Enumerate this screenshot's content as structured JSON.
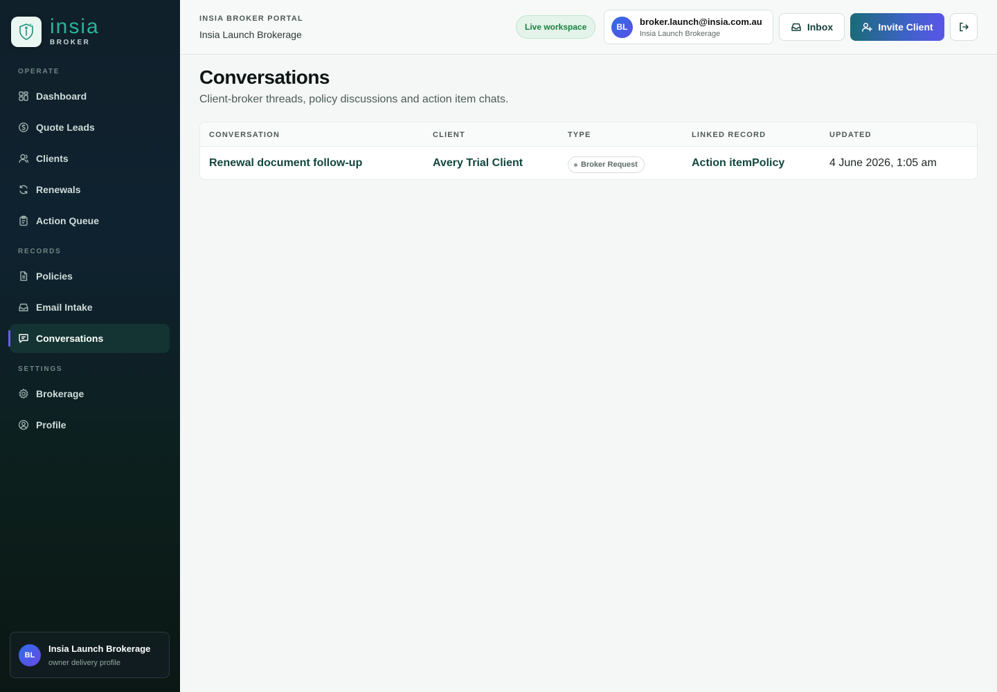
{
  "brand": {
    "name": "insia",
    "sub": "BROKER"
  },
  "sidebar": {
    "sections": {
      "operate": "OPERATE",
      "records": "RECORDS",
      "settings": "SETTINGS"
    },
    "items": [
      {
        "label": "Dashboard",
        "icon": "dashboard-icon"
      },
      {
        "label": "Quote Leads",
        "icon": "dollar-circle-icon"
      },
      {
        "label": "Clients",
        "icon": "user-icon"
      },
      {
        "label": "Renewals",
        "icon": "refresh-icon"
      },
      {
        "label": "Action Queue",
        "icon": "clipboard-icon"
      },
      {
        "label": "Policies",
        "icon": "document-icon"
      },
      {
        "label": "Email Intake",
        "icon": "inbox-icon"
      },
      {
        "label": "Conversations",
        "icon": "chat-icon",
        "active": true
      },
      {
        "label": "Brokerage",
        "icon": "gear-icon"
      },
      {
        "label": "Profile",
        "icon": "user-circle-icon"
      }
    ],
    "org_card": {
      "initials": "BL",
      "name": "Insia Launch Brokerage",
      "sub": "owner delivery profile"
    }
  },
  "header": {
    "portal_label": "INSIA BROKER PORTAL",
    "portal_sub": "Insia Launch Brokerage",
    "workspace_status": "Live workspace",
    "user": {
      "initials": "BL",
      "email": "broker.launch@insia.com.au",
      "org": "Insia Launch Brokerage"
    },
    "inbox_label": "Inbox",
    "invite_label": "Invite Client"
  },
  "main": {
    "title": "Conversations",
    "subtitle": "Client-broker threads, policy discussions and action item chats.",
    "table": {
      "columns": [
        "CONVERSATION",
        "CLIENT",
        "TYPE",
        "LINKED RECORD",
        "UPDATED"
      ],
      "rows": [
        {
          "conversation": "Renewal document follow-up",
          "client": "Avery Trial Client",
          "type": "Broker Request",
          "linked_record": "Action itemPolicy",
          "updated": "4 June 2026, 1:05 am"
        }
      ]
    }
  },
  "colors": {
    "accent": "#2bb39a",
    "link": "#12463e",
    "live": "#17803f",
    "invite_start": "#1a6b78",
    "invite_end": "#5b55e8"
  }
}
